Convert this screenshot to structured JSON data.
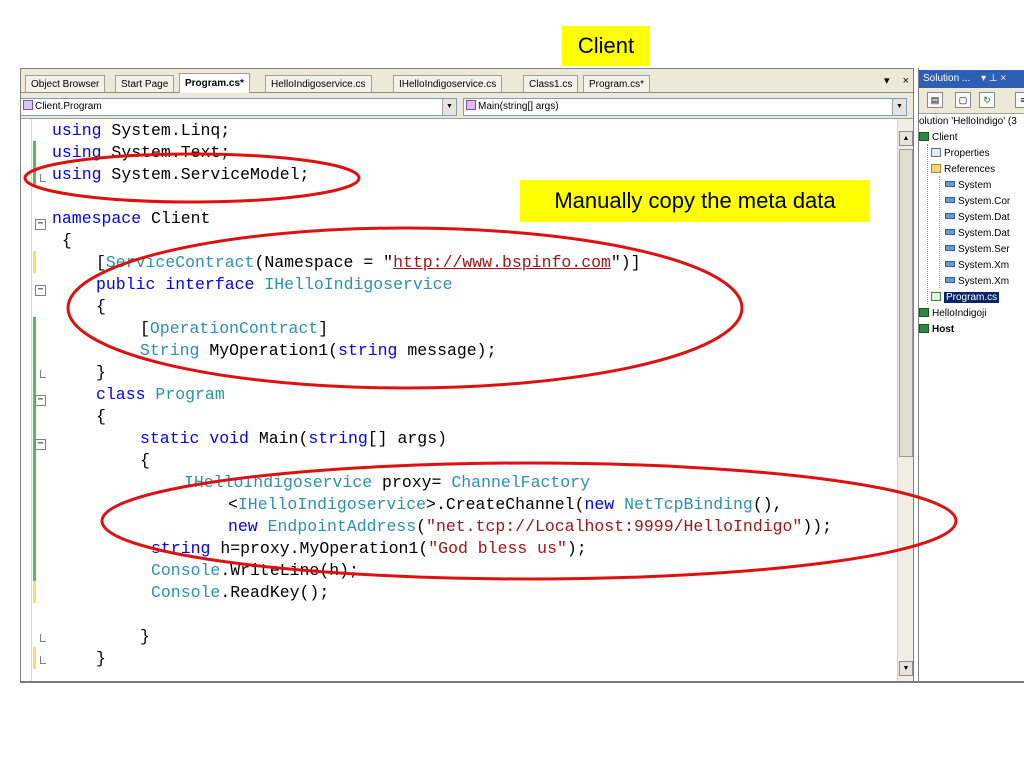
{
  "callouts": {
    "client": "Client",
    "meta": "Manually copy the meta data"
  },
  "tabs": [
    {
      "label": "Object Browser",
      "active": false
    },
    {
      "label": "Start Page",
      "active": false
    },
    {
      "label": "Program.cs*",
      "active": true
    },
    {
      "label": "HelloIndigoservice.cs",
      "active": false
    },
    {
      "label": "IHelloIndigoservice.cs",
      "active": false
    },
    {
      "label": "Class1.cs",
      "active": false
    },
    {
      "label": "Program.cs*",
      "active": false
    }
  ],
  "tab_controls": {
    "dropdown": "▾",
    "close": "×"
  },
  "navbar": {
    "class_combo": "Client.Program",
    "member_combo": "Main(string[] args)"
  },
  "code": {
    "l1": {
      "k": "using",
      "r": " System.Linq;"
    },
    "l2": {
      "k": "using",
      "r": " System.Text;"
    },
    "l3": {
      "k": "using",
      "r": " System.ServiceModel;"
    },
    "l5": {
      "k": "namespace",
      "r": " Client"
    },
    "l6": {
      "r": " {"
    },
    "l7": {
      "p1": "[",
      "t1": "ServiceContract",
      "p2": "(Namespace = \"",
      "link": "http://www.bspinfo.com",
      "p3": "\")]"
    },
    "l8": {
      "k1": "public",
      "k2": "interface",
      "t1": "IHelloIndigoservice"
    },
    "l9": {
      "r": "{"
    },
    "l10": {
      "p1": "[",
      "t1": "OperationContract",
      "p2": "]"
    },
    "l11": {
      "t1": "String",
      "p1": " MyOperation1(",
      "k1": "string",
      "p2": " message);"
    },
    "l12": {
      "r": "}"
    },
    "l13": {
      "k1": "class",
      "t1": "Program"
    },
    "l14": {
      "r": "{"
    },
    "l15": {
      "k1": "static",
      "k2": "void",
      "p1": " Main(",
      "k3": "string",
      "p2": "[] args)"
    },
    "l16": {
      "r": "{"
    },
    "l17": {
      "t1": "IHelloIndigoservice",
      "p1": " proxy= ",
      "t2": "ChannelFactory"
    },
    "l18": {
      "p1": "<",
      "t1": "IHelloIndigoservice",
      "p2": ">.CreateChannel(",
      "k1": "new",
      "t2": "NetTcpBinding",
      "p3": "(),"
    },
    "l19": {
      "k1": "new",
      "t1": "EndpointAddress",
      "p1": "(",
      "s1": "\"net.tcp://Localhost:9999/HelloIndigo\"",
      "p2": "));"
    },
    "l20": {
      "k1": "string",
      "p1": " h=proxy.MyOperation1(",
      "s1": "\"God bless us\"",
      "p2": ");"
    },
    "l21": {
      "t1": "Console",
      "p1": ".WriteLine(h);"
    },
    "l22": {
      "t1": "Console",
      "p1": ".ReadKey();"
    },
    "l24": {
      "r": "}"
    },
    "l25": {
      "r": "}"
    }
  },
  "solution": {
    "title": "Solution ...",
    "title_controls": "▾ ⊥ ×",
    "root": "olution 'HelloIndigo' (3",
    "items": {
      "client": "Client",
      "properties": "Properties",
      "references": "References",
      "ref1": "System",
      "ref2": "System.Cor",
      "ref3": "System.Dat",
      "ref4": "System.Dat",
      "ref5": "System.Ser",
      "ref6": "System.Xm",
      "ref7": "System.Xm",
      "program": "Program.cs",
      "helloindigo": "HelloIndigoji",
      "host": "Host"
    }
  },
  "colors": {
    "callout_bg": "#ffff00",
    "ellipse": "#e01010",
    "keyword": "#0000ff",
    "type": "#2b91af",
    "string": "#a31515"
  }
}
